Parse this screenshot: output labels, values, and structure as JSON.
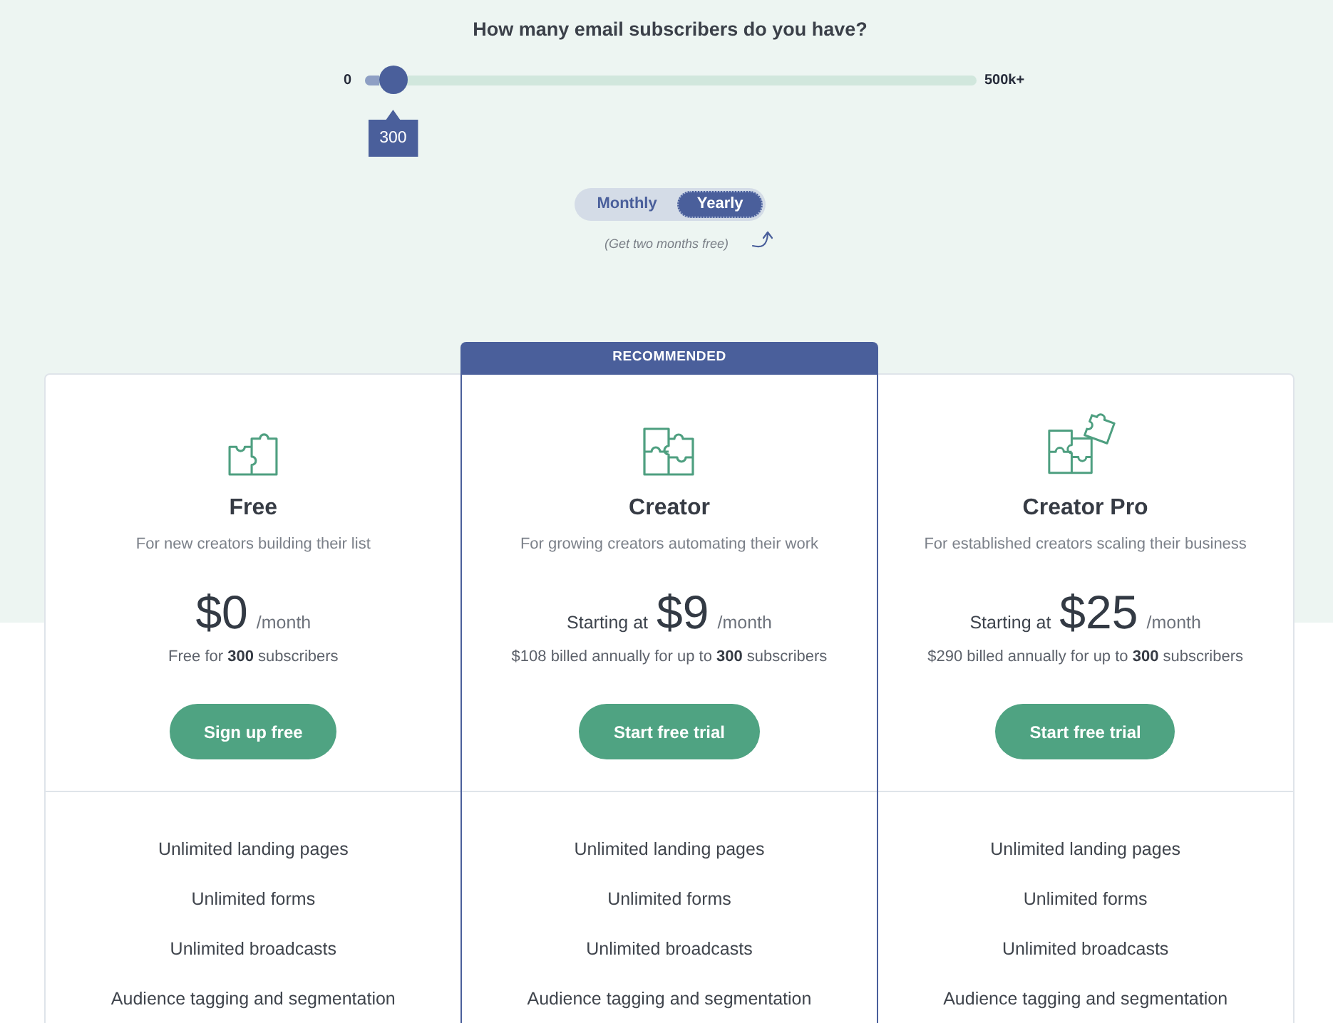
{
  "question": "How many email subscribers do you have?",
  "slider": {
    "min_label": "0",
    "max_label": "500k+",
    "level": 0.025,
    "value_label": "300"
  },
  "billing_toggle": {
    "options": [
      {
        "label": "Monthly",
        "selected": false
      },
      {
        "label": "Yearly",
        "selected": true
      }
    ],
    "note": "(Get two months free)"
  },
  "plans": [
    {
      "name": "Free",
      "highlighted": false,
      "tagline": "For new creators building their list",
      "price": "$0",
      "period": "/month",
      "billing_note": "Free for **300** subscribers",
      "button": "Sign up free",
      "features": [
        "Unlimited landing pages",
        "Unlimited forms",
        "Unlimited broadcasts",
        "Audience tagging and segmentation"
      ]
    },
    {
      "badge": "RECOMMENDED",
      "name": "Creator",
      "highlighted": true,
      "tagline": "For growing creators automating their work",
      "price_prefix": "Starting at",
      "price": "$9",
      "period": "/month",
      "billing_note": "$108 billed annually for up to **300** subscribers",
      "button": "Start free trial",
      "features": [
        "Unlimited landing pages",
        "Unlimited forms",
        "Unlimited broadcasts",
        "Audience tagging and segmentation"
      ]
    },
    {
      "name": "Creator Pro",
      "highlighted": false,
      "tagline": "For established creators scaling their business",
      "price_prefix": "Starting at",
      "price": "$25",
      "period": "/month",
      "billing_note": "$290 billed annually for up to **300** subscribers",
      "button": "Start free trial",
      "features": [
        "Unlimited landing pages",
        "Unlimited forms",
        "Unlimited broadcasts",
        "Audience tagging and segmentation"
      ]
    }
  ]
}
